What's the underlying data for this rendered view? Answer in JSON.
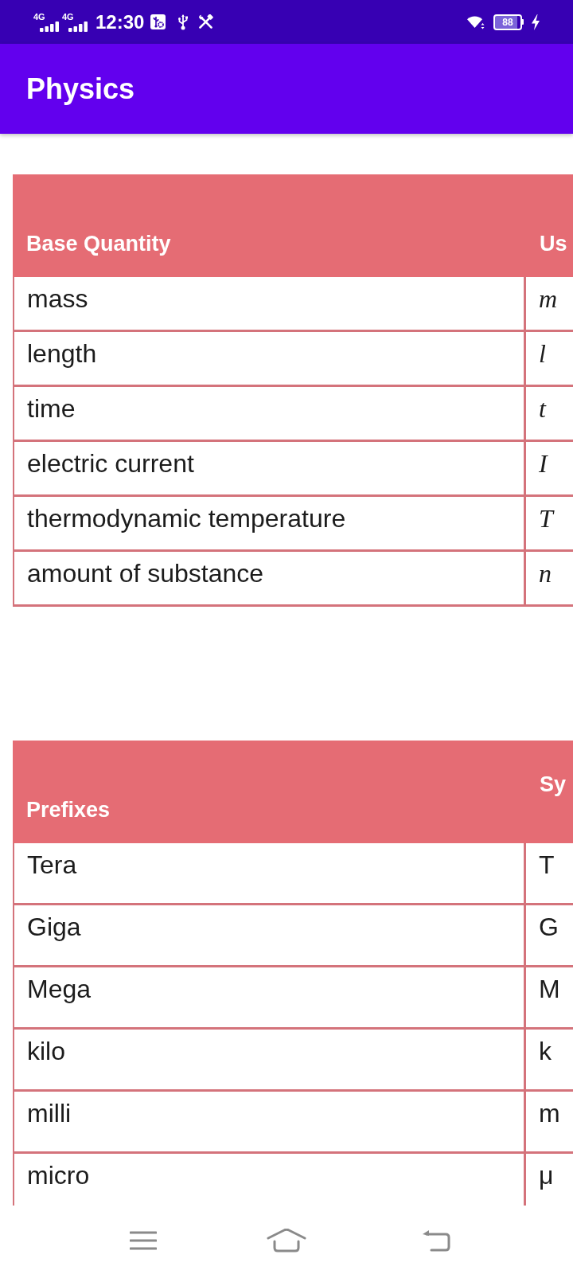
{
  "status_bar": {
    "network_types": [
      "4G",
      "4G"
    ],
    "time": "12:30",
    "battery": "88"
  },
  "app_bar": {
    "title": "Physics"
  },
  "tables": [
    {
      "columns": [
        "Base Quantity",
        "Us"
      ],
      "rows": [
        [
          "mass",
          "m"
        ],
        [
          "length",
          "l"
        ],
        [
          "time",
          "t"
        ],
        [
          "electric current",
          "I"
        ],
        [
          "thermodynamic temperature",
          "T"
        ],
        [
          "amount of substance",
          "n"
        ]
      ]
    },
    {
      "columns": [
        "Prefixes",
        "Sy"
      ],
      "rows": [
        [
          "Tera",
          "T"
        ],
        [
          "Giga",
          "G"
        ],
        [
          "Mega",
          "M"
        ],
        [
          "kilo",
          "k"
        ],
        [
          "milli",
          "m"
        ],
        [
          "micro",
          "μ"
        ]
      ]
    }
  ]
}
